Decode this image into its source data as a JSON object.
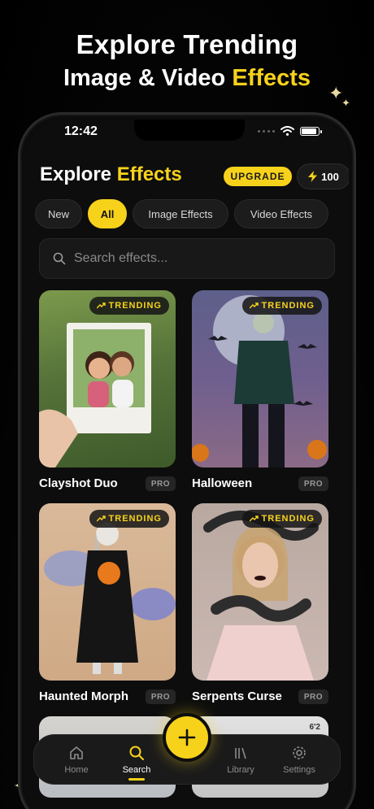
{
  "hero": {
    "line1": "Explore Trending",
    "line2_prefix": "Image & Video ",
    "line2_accent": "Effects"
  },
  "status_bar": {
    "time": "12:42",
    "icons": [
      "cellular-dots-icon",
      "wifi-icon",
      "battery-icon"
    ],
    "battery_level": 0.9
  },
  "header": {
    "title_prefix": "Explore ",
    "title_accent": "Effects",
    "upgrade_label": "UPGRADE",
    "credits": "100",
    "credits_icon": "bolt-icon"
  },
  "filters": [
    {
      "label": "New",
      "active": false
    },
    {
      "label": "All",
      "active": true
    },
    {
      "label": "Image Effects",
      "active": false
    },
    {
      "label": "Video Effects",
      "active": false
    }
  ],
  "search": {
    "placeholder": "Search effects...",
    "icon": "search-icon"
  },
  "effects": [
    {
      "name": "Clayshot Duo",
      "badge": "TRENDING",
      "tier": "PRO"
    },
    {
      "name": "Halloween",
      "badge": "TRENDING",
      "tier": "PRO"
    },
    {
      "name": "Haunted Morph",
      "badge": "TRENDING",
      "tier": "PRO"
    },
    {
      "name": "Serpents Curse",
      "badge": "TRENDING",
      "tier": "PRO"
    }
  ],
  "peek_card_text": "6'2",
  "tab_bar": {
    "tabs": [
      {
        "label": "Home",
        "icon": "home-icon"
      },
      {
        "label": "Search",
        "icon": "search-icon",
        "active": true
      },
      {
        "label": "Library",
        "icon": "library-icon"
      },
      {
        "label": "Settings",
        "icon": "gear-icon"
      }
    ],
    "fab_icon": "plus-icon"
  },
  "colors": {
    "accent": "#f7d21b",
    "background": "#0d0d0d",
    "chip": "#1c1c1c"
  }
}
